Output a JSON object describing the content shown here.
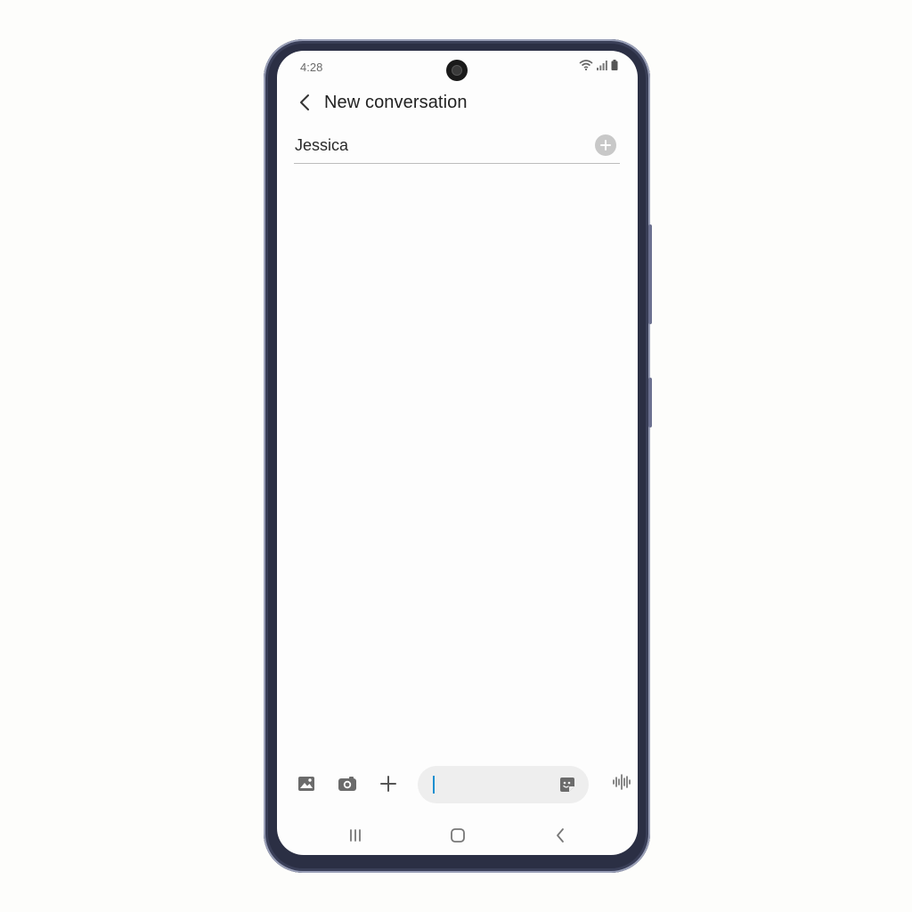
{
  "status_bar": {
    "time": "4:28",
    "icons": [
      "wifi-icon",
      "signal-icon",
      "battery-icon"
    ]
  },
  "header": {
    "title": "New conversation",
    "back_icon": "chevron-left-icon"
  },
  "recipient": {
    "value": "Jessica",
    "add_icon": "plus-circle-icon"
  },
  "composer": {
    "buttons": [
      "gallery-icon",
      "camera-icon",
      "plus-icon"
    ],
    "message_placeholder": "",
    "sticker_icon": "sticker-icon",
    "voice_icon": "voice-waveform-icon"
  },
  "nav_bar": {
    "buttons": [
      "recent-apps-icon",
      "home-icon",
      "back-icon"
    ]
  },
  "colors": {
    "phone_frame": "#2b2f44",
    "screen_bg": "#fdfdfd",
    "caret": "#1a8fd0",
    "icon_gray": "#6b6b6b"
  }
}
